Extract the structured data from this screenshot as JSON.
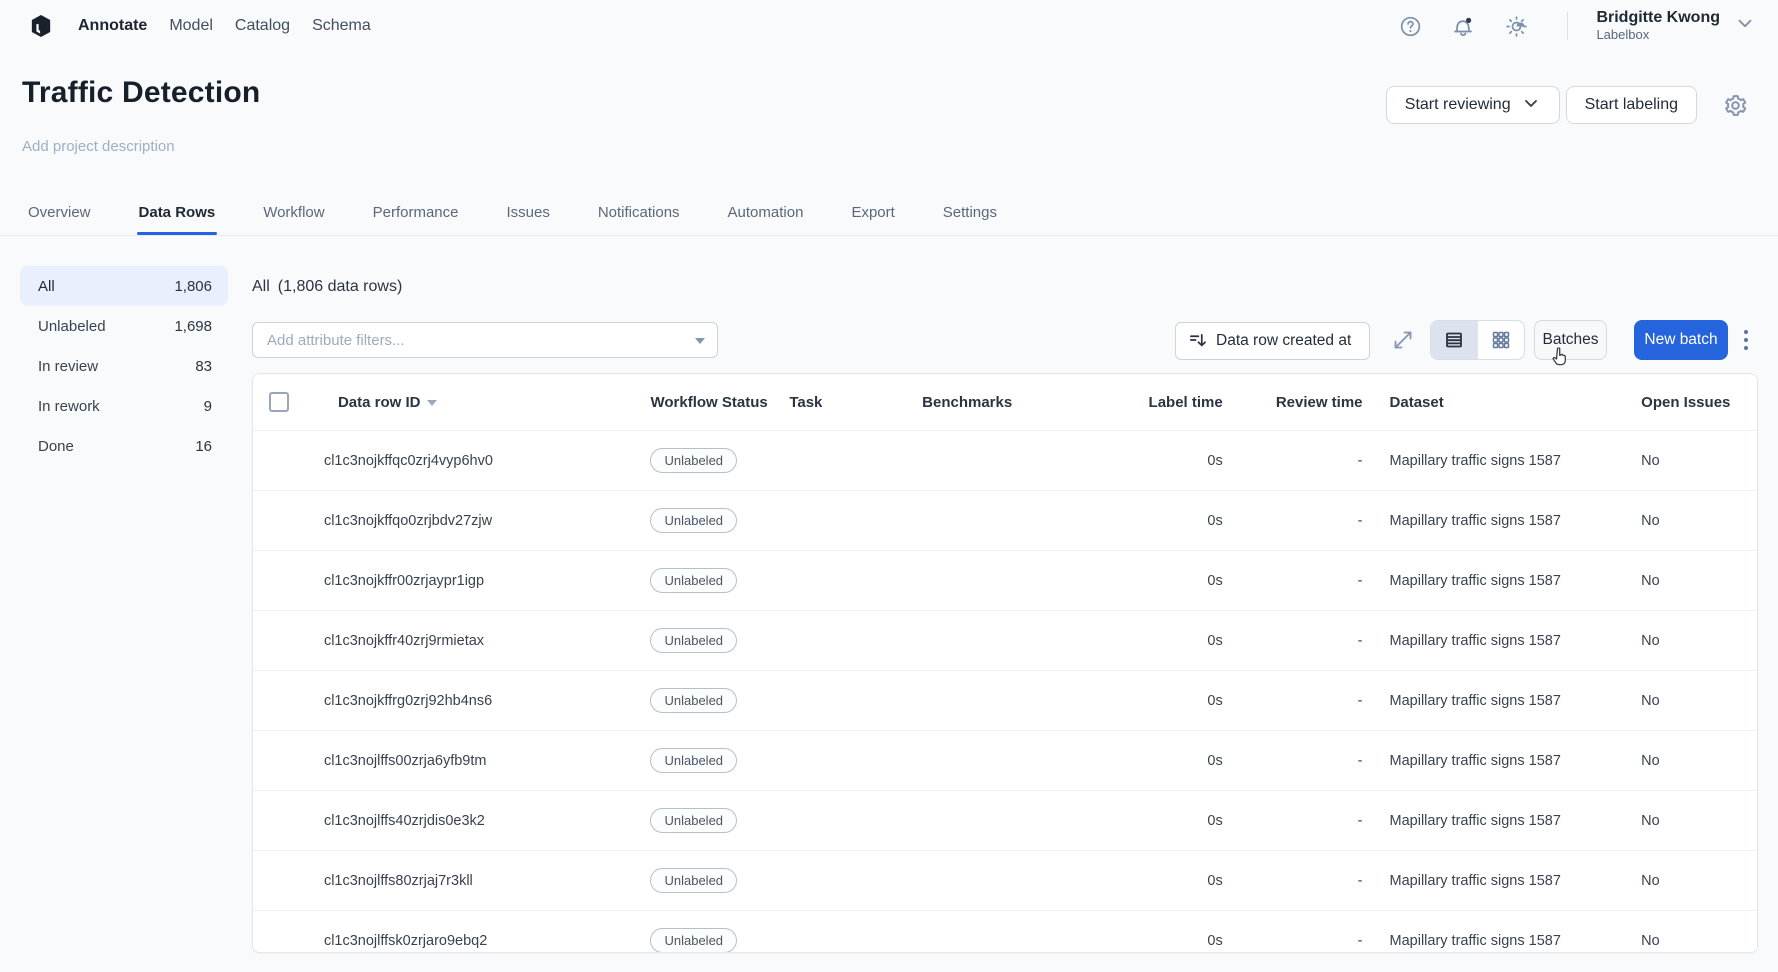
{
  "colors": {
    "accent": "#2564dc",
    "sidebar_active_bg": "#e9effc",
    "notification_dot": "#333c49"
  },
  "nav": {
    "brand_icon": "labelbox-cube",
    "items": [
      {
        "label": "Annotate",
        "active": true
      },
      {
        "label": "Model",
        "active": false
      },
      {
        "label": "Catalog",
        "active": false
      },
      {
        "label": "Schema",
        "active": false
      }
    ],
    "icons": [
      "help-circle-icon",
      "bell-notification-icon",
      "brightness-icon"
    ],
    "user": {
      "name": "Bridgitte Kwong",
      "org": "Labelbox"
    }
  },
  "header": {
    "title": "Traffic Detection",
    "description_placeholder": "Add project description",
    "buttons": {
      "start_reviewing": "Start reviewing",
      "start_labeling": "Start labeling"
    }
  },
  "tabs": [
    {
      "label": "Overview",
      "active": false
    },
    {
      "label": "Data Rows",
      "active": true
    },
    {
      "label": "Workflow",
      "active": false
    },
    {
      "label": "Performance",
      "active": false
    },
    {
      "label": "Issues",
      "active": false
    },
    {
      "label": "Notifications",
      "active": false
    },
    {
      "label": "Automation",
      "active": false
    },
    {
      "label": "Export",
      "active": false
    },
    {
      "label": "Settings",
      "active": false
    }
  ],
  "sidebar": {
    "filters": [
      {
        "label": "All",
        "count": "1,806",
        "active": true
      },
      {
        "label": "Unlabeled",
        "count": "1,698",
        "active": false
      },
      {
        "label": "In review",
        "count": "83",
        "active": false
      },
      {
        "label": "In rework",
        "count": "9",
        "active": false
      },
      {
        "label": "Done",
        "count": "16",
        "active": false
      }
    ]
  },
  "toolbar": {
    "heading_filter": "All",
    "heading_count": "(1,806 data rows)",
    "filter_placeholder": "Add attribute filters...",
    "sort_label": "Data row created at",
    "batches_label": "Batches",
    "new_batch_label": "New batch"
  },
  "table": {
    "columns": [
      "Data row ID",
      "Workflow Status",
      "Task",
      "Benchmarks",
      "Label time",
      "Review time",
      "Dataset",
      "Open Issues"
    ],
    "rows": [
      {
        "id": "cl1c3nojkffqc0zrj4vyp6hv0",
        "status": "Unlabeled",
        "task": "",
        "benchmarks": "",
        "label_time": "0s",
        "review_time": "-",
        "dataset": "Mapillary traffic signs 1587",
        "open_issues": "No"
      },
      {
        "id": "cl1c3nojkffqo0zrjbdv27zjw",
        "status": "Unlabeled",
        "task": "",
        "benchmarks": "",
        "label_time": "0s",
        "review_time": "-",
        "dataset": "Mapillary traffic signs 1587",
        "open_issues": "No"
      },
      {
        "id": "cl1c3nojkffr00zrjaypr1igp",
        "status": "Unlabeled",
        "task": "",
        "benchmarks": "",
        "label_time": "0s",
        "review_time": "-",
        "dataset": "Mapillary traffic signs 1587",
        "open_issues": "No"
      },
      {
        "id": "cl1c3nojkffr40zrj9rmietax",
        "status": "Unlabeled",
        "task": "",
        "benchmarks": "",
        "label_time": "0s",
        "review_time": "-",
        "dataset": "Mapillary traffic signs 1587",
        "open_issues": "No"
      },
      {
        "id": "cl1c3nojkffrg0zrj92hb4ns6",
        "status": "Unlabeled",
        "task": "",
        "benchmarks": "",
        "label_time": "0s",
        "review_time": "-",
        "dataset": "Mapillary traffic signs 1587",
        "open_issues": "No"
      },
      {
        "id": "cl1c3nojlffs00zrja6yfb9tm",
        "status": "Unlabeled",
        "task": "",
        "benchmarks": "",
        "label_time": "0s",
        "review_time": "-",
        "dataset": "Mapillary traffic signs 1587",
        "open_issues": "No"
      },
      {
        "id": "cl1c3nojlffs40zrjdis0e3k2",
        "status": "Unlabeled",
        "task": "",
        "benchmarks": "",
        "label_time": "0s",
        "review_time": "-",
        "dataset": "Mapillary traffic signs 1587",
        "open_issues": "No"
      },
      {
        "id": "cl1c3nojlffs80zrjaj7r3kll",
        "status": "Unlabeled",
        "task": "",
        "benchmarks": "",
        "label_time": "0s",
        "review_time": "-",
        "dataset": "Mapillary traffic signs 1587",
        "open_issues": "No"
      },
      {
        "id": "cl1c3nojlffsk0zrjaro9ebq2",
        "status": "Unlabeled",
        "task": "",
        "benchmarks": "",
        "label_time": "0s",
        "review_time": "-",
        "dataset": "Mapillary traffic signs 1587",
        "open_issues": "No"
      }
    ]
  }
}
